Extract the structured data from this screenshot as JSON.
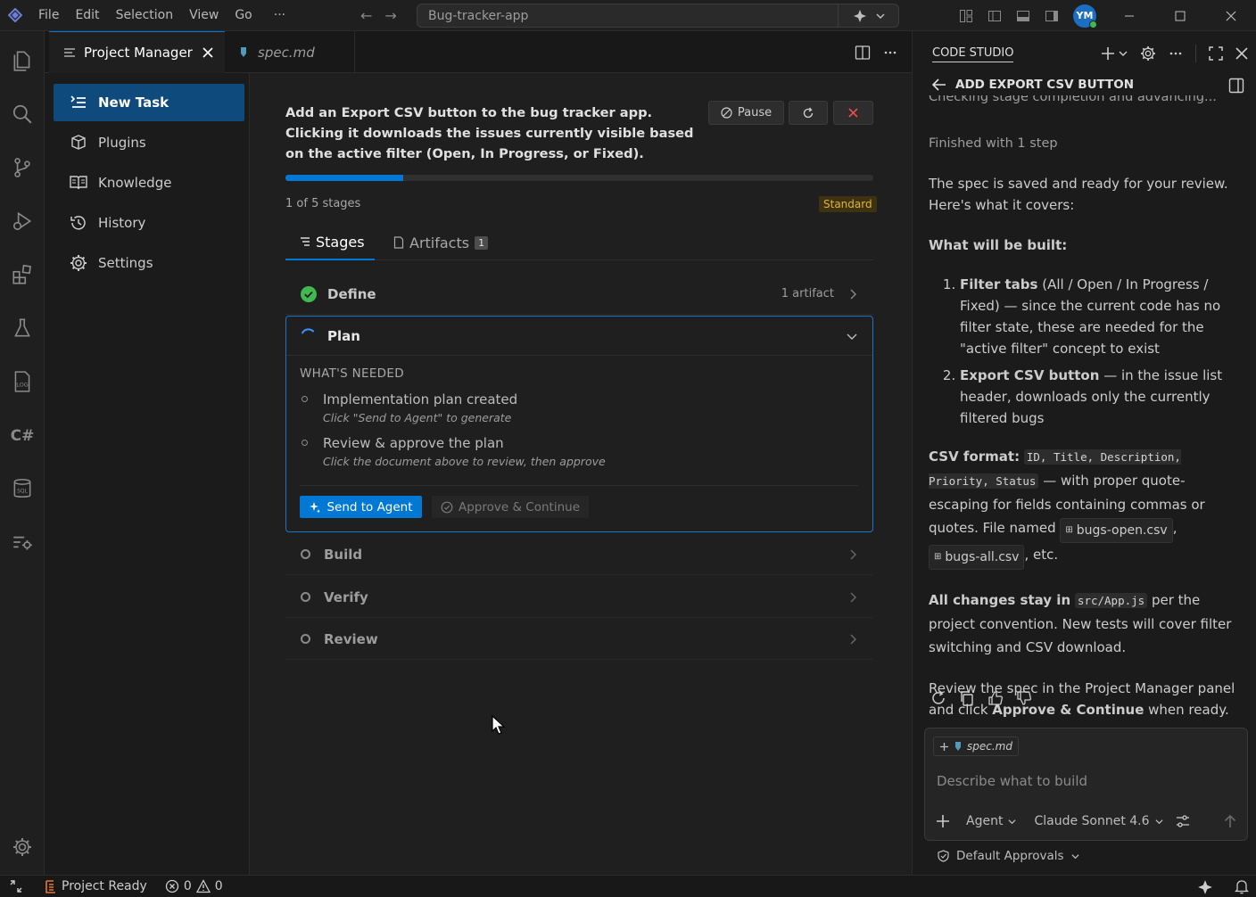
{
  "titlebar": {
    "menu": [
      "File",
      "Edit",
      "Selection",
      "View",
      "Go",
      "···"
    ],
    "command_center": "Bug-tracker-app",
    "avatar_initials": "YM"
  },
  "tabs": {
    "active_label": "Project Manager",
    "inactive_label": "spec.md"
  },
  "sidebar": {
    "items": [
      {
        "label": "New Task",
        "icon": "new-task-icon"
      },
      {
        "label": "Plugins",
        "icon": "plugins-icon"
      },
      {
        "label": "Knowledge",
        "icon": "book-icon"
      },
      {
        "label": "History",
        "icon": "history-icon"
      },
      {
        "label": "Settings",
        "icon": "gear-icon"
      }
    ]
  },
  "task": {
    "description": "Add an Export CSV button to the bug tracker app. Clicking it downloads the issues currently visible based on the active filter (Open, In Progress, or Fixed).",
    "pause_label": "Pause",
    "progress_fraction": 0.2,
    "stage_count": "1 of 5 stages",
    "mode_badge": "Standard"
  },
  "subtabs": {
    "stages": "Stages",
    "artifacts": "Artifacts",
    "artifacts_count": "1"
  },
  "stages": {
    "define": {
      "label": "Define",
      "meta": "1 artifact"
    },
    "plan": {
      "label": "Plan",
      "needed_title": "WHAT'S NEEDED",
      "items": [
        {
          "label": "Implementation plan created",
          "hint": "Click \"Send to Agent\" to generate"
        },
        {
          "label": "Review & approve the plan",
          "hint": "Click the document above to review, then approve"
        }
      ],
      "send_label": "Send to Agent",
      "approve_label": "Approve & Continue"
    },
    "build": {
      "label": "Build"
    },
    "verify": {
      "label": "Verify"
    },
    "review": {
      "label": "Review"
    }
  },
  "chat": {
    "panel_title": "CODE STUDIO",
    "session_title": "ADD EXPORT CSV BUTTON",
    "truncated_line": "Checking stage completion and advancing...",
    "finished_prefix": "Finished",
    "finished_suffix": "with 1 step",
    "intro": "The spec is saved and ready for your review. Here's what it covers:",
    "built_heading": "What will be built:",
    "item1_bold": "Filter tabs",
    "item1_rest": " (All / Open / In Progress / Fixed) — since the current code has no filter state, these are needed for the \"active filter\" concept to exist",
    "item2_bold": "Export CSV button",
    "item2_rest": " — in the issue list header, downloads only the currently filtered bugs",
    "csv_label": "CSV format:",
    "csv_code": "ID, Title, Description, Priority, Status",
    "csv_rest": " — with proper quote-escaping for fields containing commas or quotes. File named ",
    "file1": "bugs-open.csv",
    "file2": "bugs-all.csv",
    "csv_end": ", etc.",
    "changes_bold": "All changes stay in",
    "changes_code": "src/App.js",
    "changes_rest": " per the project convention. New tests will cover filter switching and CSV download.",
    "review_prefix": "Review the spec in the Project Manager panel and click ",
    "review_bold": "Approve & Continue",
    "review_suffix": " when ready.",
    "attachment": "spec.md",
    "input_placeholder": "Describe what to build",
    "mode": "Agent",
    "model": "Claude Sonnet 4.6",
    "approvals": "Default Approvals"
  },
  "statusbar": {
    "project_status": "Project Ready",
    "errors": "0",
    "warnings": "0"
  },
  "colors": {
    "accent": "#0078d4",
    "success": "#3fb950",
    "badge": "#e2b340",
    "danger": "#f14c4c"
  }
}
